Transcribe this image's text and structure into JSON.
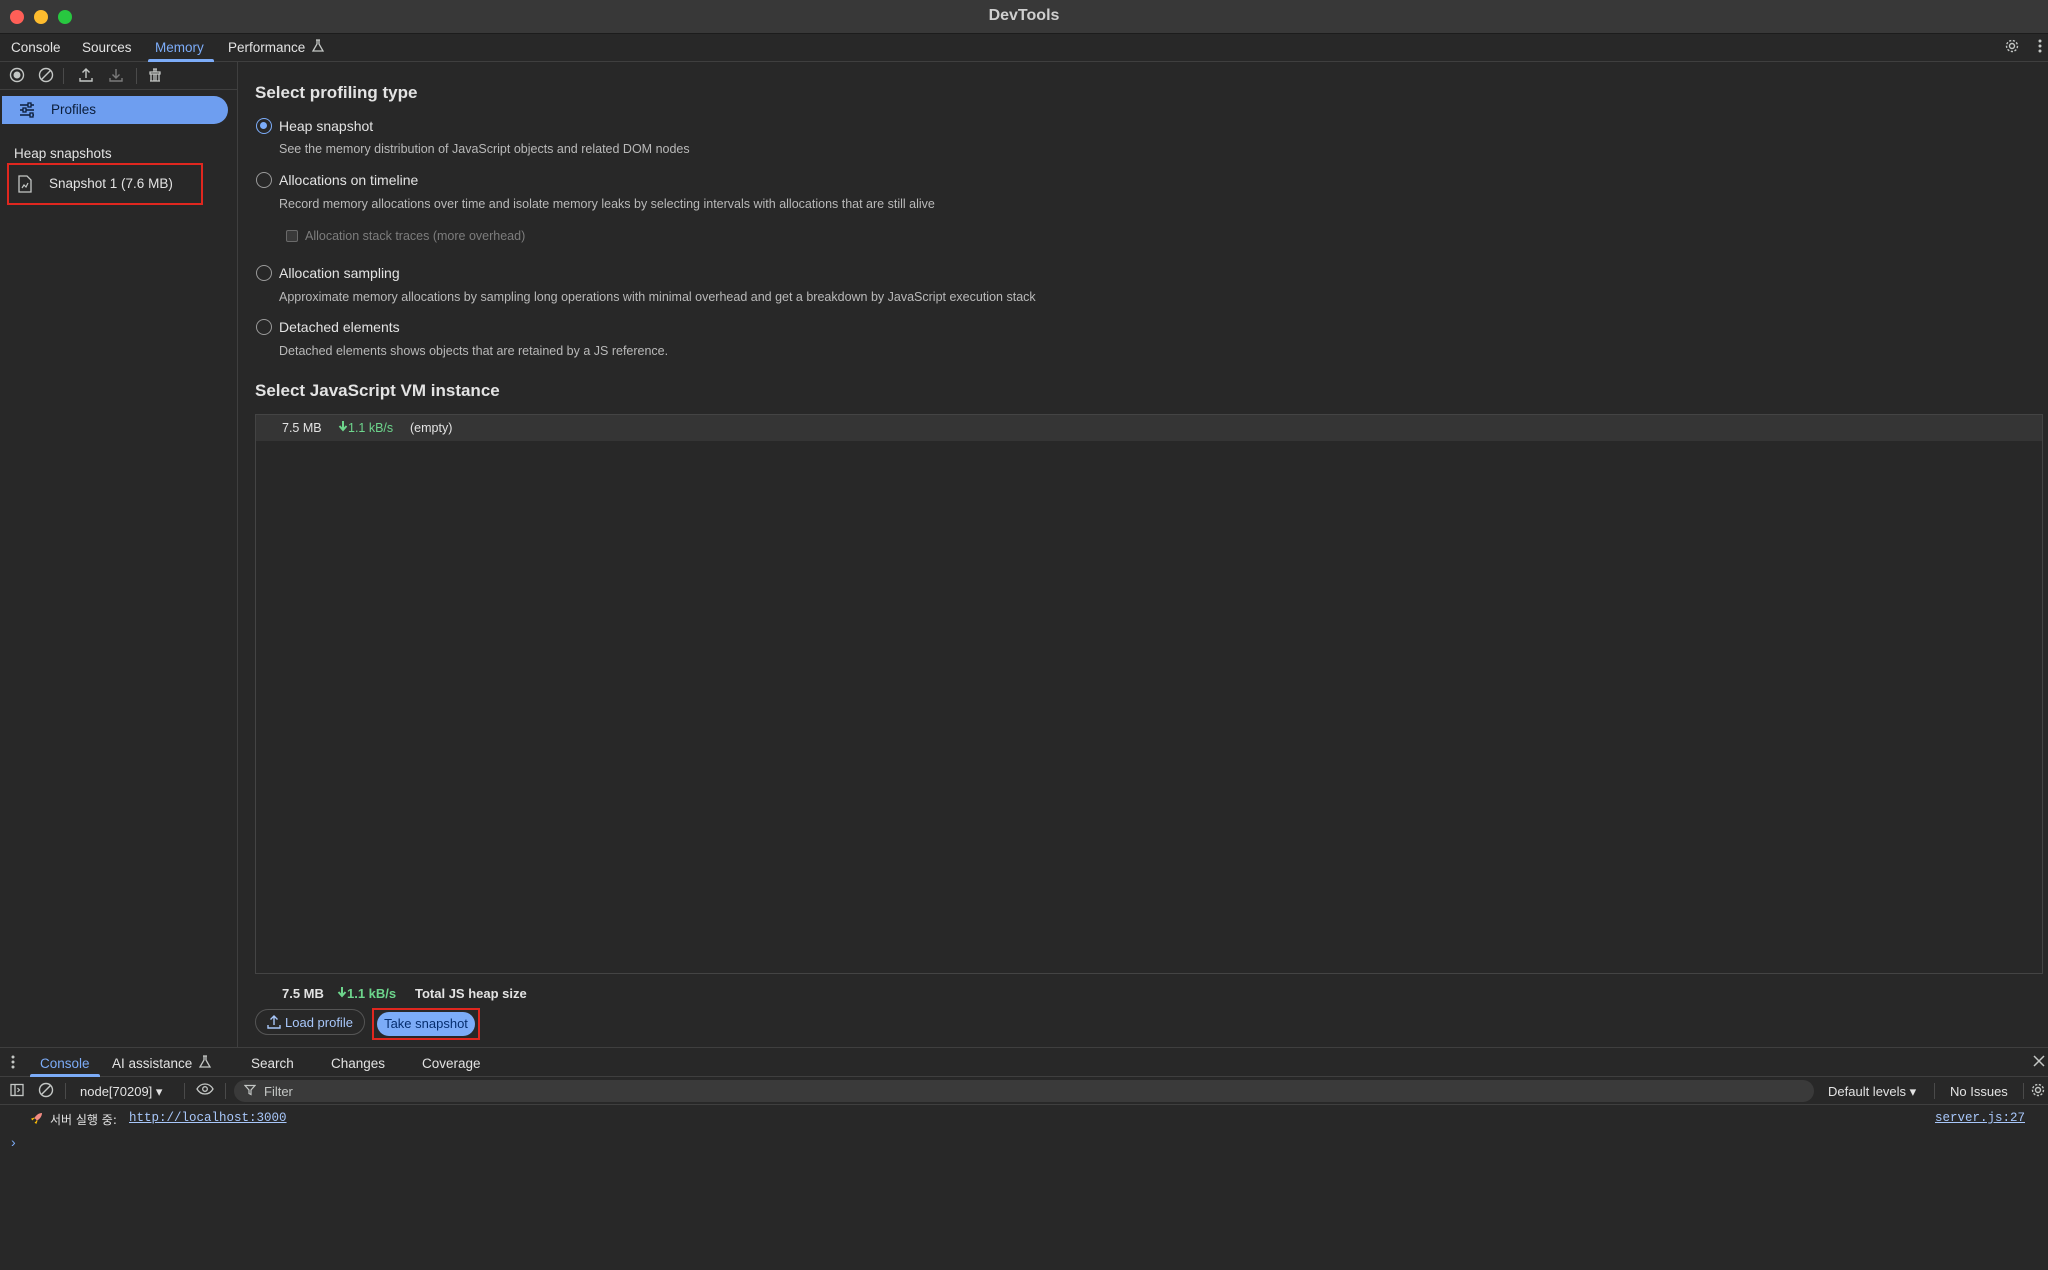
{
  "window": {
    "title": "DevTools"
  },
  "tabs": [
    {
      "label": "Console"
    },
    {
      "label": "Sources"
    },
    {
      "label": "Memory"
    },
    {
      "label": "Performance"
    }
  ],
  "sidebar": {
    "profiles_label": "Profiles",
    "heading": "Heap snapshots",
    "snapshot_label": "Snapshot 1 (7.6 MB)"
  },
  "profiling": {
    "title": "Select profiling type",
    "options": [
      {
        "label": "Heap snapshot",
        "desc": "See the memory distribution of JavaScript objects and related DOM nodes",
        "checked": true
      },
      {
        "label": "Allocations on timeline",
        "desc": "Record memory allocations over time and isolate memory leaks by selecting intervals with allocations that are still alive",
        "checked": false
      },
      {
        "label": "Allocation sampling",
        "desc": "Approximate memory allocations by sampling long operations with minimal overhead and get a breakdown by JavaScript execution stack",
        "checked": false
      },
      {
        "label": "Detached elements",
        "desc": "Detached elements shows objects that are retained by a JS reference.",
        "checked": false
      }
    ],
    "checkbox_label": "Allocation stack traces (more overhead)"
  },
  "vm": {
    "title": "Select JavaScript VM instance",
    "row": {
      "size": "7.5 MB",
      "rate": "1.1 kB/s",
      "name": "(empty)"
    }
  },
  "footer": {
    "total_size": "7.5 MB",
    "total_rate": "1.1 kB/s",
    "total_label": "Total JS heap size",
    "load_label": "Load profile",
    "snapshot_button": "Take snapshot"
  },
  "drawer": {
    "tabs": [
      {
        "label": "Console"
      },
      {
        "label": "AI assistance"
      },
      {
        "label": "Search"
      },
      {
        "label": "Changes"
      },
      {
        "label": "Coverage"
      }
    ]
  },
  "console": {
    "context": "node[70209]",
    "filter_placeholder": "Filter",
    "levels": "Default levels",
    "issues": "No Issues",
    "log": {
      "message": "서버 실행 중:",
      "link": "http://localhost:3000",
      "source": "server.js:27"
    },
    "prompt": "›"
  },
  "colors": {
    "accent": "#7cacf8",
    "highlight_box": "#e0271f",
    "rate_green": "#6dd58c",
    "background": "#282828"
  }
}
